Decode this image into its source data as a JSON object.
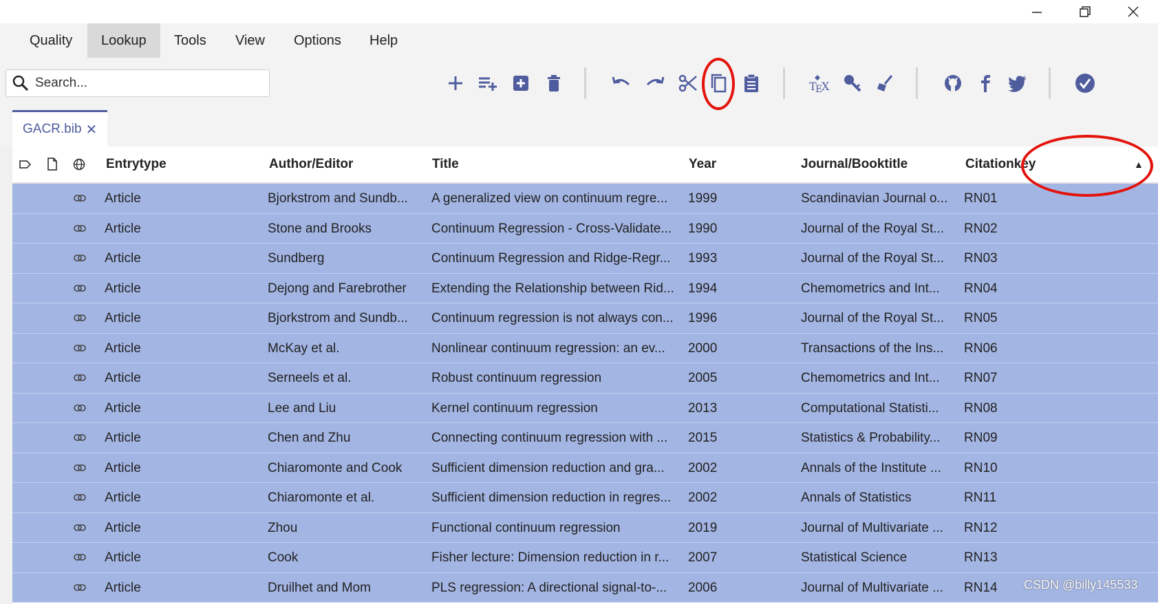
{
  "menu": {
    "items": [
      {
        "label": "Quality",
        "active": false
      },
      {
        "label": "Lookup",
        "active": true
      },
      {
        "label": "Tools",
        "active": false
      },
      {
        "label": "View",
        "active": false
      },
      {
        "label": "Options",
        "active": false
      },
      {
        "label": "Help",
        "active": false
      }
    ]
  },
  "search": {
    "placeholder": "Search..."
  },
  "toolbar": {
    "icons": [
      "add-icon",
      "add-list-icon",
      "add-box-icon",
      "delete-icon",
      "undo-icon",
      "redo-icon",
      "cut-icon",
      "copy-icon",
      "paste-icon",
      "tex-icon",
      "key-icon",
      "cleanup-icon",
      "github-icon",
      "facebook-icon",
      "twitter-icon",
      "check-icon"
    ],
    "accent": "#4f5c9e"
  },
  "tab": {
    "label": "GACR.bib",
    "close": "✕"
  },
  "table": {
    "headers": [
      "Entrytype",
      "Author/Editor",
      "Title",
      "Year",
      "Journal/Booktitle",
      "Citationkey"
    ],
    "sort_indicator": "▲",
    "selected_row_color": "#a3b5e3",
    "rows": [
      {
        "type": "Article",
        "author": "Bjorkstrom and Sundb...",
        "title": "A generalized view on continuum regre...",
        "year": "1999",
        "journal": "Scandinavian Journal o...",
        "key": "RN01"
      },
      {
        "type": "Article",
        "author": "Stone and Brooks",
        "title": "Continuum Regression - Cross-Validate...",
        "year": "1990",
        "journal": "Journal of the Royal St...",
        "key": "RN02"
      },
      {
        "type": "Article",
        "author": "Sundberg",
        "title": "Continuum Regression and Ridge-Regr...",
        "year": "1993",
        "journal": "Journal of the Royal St...",
        "key": "RN03"
      },
      {
        "type": "Article",
        "author": "Dejong and Farebrother",
        "title": "Extending the Relationship between Rid...",
        "year": "1994",
        "journal": "Chemometrics and Int...",
        "key": "RN04"
      },
      {
        "type": "Article",
        "author": "Bjorkstrom and Sundb...",
        "title": "Continuum regression is not always con...",
        "year": "1996",
        "journal": "Journal of the Royal St...",
        "key": "RN05"
      },
      {
        "type": "Article",
        "author": "McKay et al.",
        "title": "Nonlinear continuum regression: an ev...",
        "year": "2000",
        "journal": "Transactions of the Ins...",
        "key": "RN06"
      },
      {
        "type": "Article",
        "author": "Serneels et al.",
        "title": "Robust continuum regression",
        "year": "2005",
        "journal": "Chemometrics and Int...",
        "key": "RN07"
      },
      {
        "type": "Article",
        "author": "Lee and Liu",
        "title": "Kernel continuum regression",
        "year": "2013",
        "journal": "Computational Statisti...",
        "key": "RN08"
      },
      {
        "type": "Article",
        "author": "Chen and Zhu",
        "title": "Connecting continuum regression with ...",
        "year": "2015",
        "journal": "Statistics & Probability...",
        "key": "RN09"
      },
      {
        "type": "Article",
        "author": "Chiaromonte and Cook",
        "title": "Sufficient dimension reduction and gra...",
        "year": "2002",
        "journal": "Annals of the Institute ...",
        "key": "RN10"
      },
      {
        "type": "Article",
        "author": "Chiaromonte et al.",
        "title": "Sufficient dimension reduction in regres...",
        "year": "2002",
        "journal": "Annals of Statistics",
        "key": "RN11"
      },
      {
        "type": "Article",
        "author": "Zhou",
        "title": "Functional continuum regression",
        "year": "2019",
        "journal": "Journal of Multivariate ...",
        "key": "RN12"
      },
      {
        "type": "Article",
        "author": "Cook",
        "title": "Fisher lecture: Dimension reduction in r...",
        "year": "2007",
        "journal": "Statistical Science",
        "key": "RN13"
      },
      {
        "type": "Article",
        "author": "Druilhet and Mom",
        "title": "PLS regression: A directional signal-to-...",
        "year": "2006",
        "journal": "Journal of Multivariate ...",
        "key": "RN14"
      }
    ]
  },
  "watermark": "CSDN @billy145533"
}
